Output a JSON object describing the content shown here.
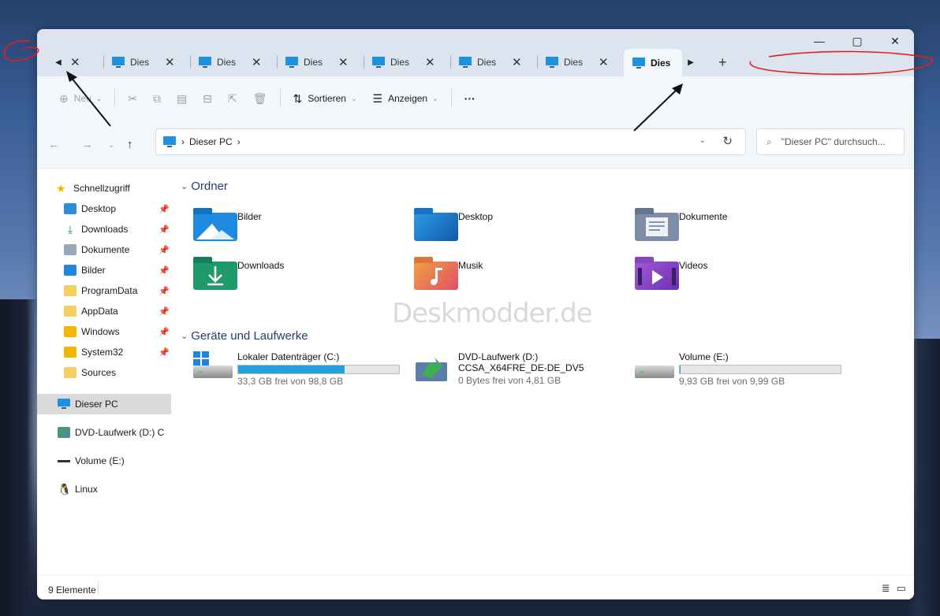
{
  "tabs": {
    "titles": [
      "Dies",
      "Dies",
      "Dies",
      "Dies",
      "Dies",
      "Dies"
    ],
    "active_title": "Dies",
    "close_glyph": "✕",
    "scroll_left_glyph": "◀",
    "scroll_right_glyph": "▶",
    "new_tab_glyph": "+"
  },
  "window_controls": {
    "minimize": "—",
    "maximize": "▢",
    "close": "✕"
  },
  "commandbar": {
    "new_label": "Neu",
    "sort_label": "Sortieren",
    "view_label": "Anzeigen",
    "more_label": "···"
  },
  "address": {
    "crumb": "Dieser PC",
    "search_placeholder": "\"Dieser PC\" durchsuch..."
  },
  "sidebar": {
    "quick_access": "Schnellzugriff",
    "items": [
      "Desktop",
      "Downloads",
      "Dokumente",
      "Bilder",
      "ProgramData",
      "AppData",
      "Windows",
      "System32",
      "Sources"
    ],
    "this_pc": "Dieser PC",
    "dvd": "DVD-Laufwerk (D:) C",
    "volume": "Volume (E:)",
    "linux": "Linux"
  },
  "content": {
    "folders_header": "Ordner",
    "folders": [
      "Bilder",
      "Desktop",
      "Dokumente",
      "Downloads",
      "Musik",
      "Videos"
    ],
    "drives_header": "Geräte und Laufwerke",
    "drives": [
      {
        "name": "Lokaler Datenträger (C:)",
        "free": "33,3 GB frei von 98,8 GB",
        "used_fraction": 0.663
      },
      {
        "name": "DVD-Laufwerk (D:)",
        "label2": "CCSA_X64FRE_DE-DE_DV5",
        "free": "0 Bytes frei von 4,81 GB"
      },
      {
        "name": "Volume (E:)",
        "free": "9,93 GB frei von 9,99 GB",
        "used_fraction": 0.006
      }
    ]
  },
  "status": {
    "count": "9 Elemente"
  },
  "watermark": "Deskmodder.de",
  "colors": {
    "accent": "#26a0da",
    "tab_bar": "#dce4ef",
    "command_bar": "#f3f7fb",
    "annotation": "#e02020"
  }
}
